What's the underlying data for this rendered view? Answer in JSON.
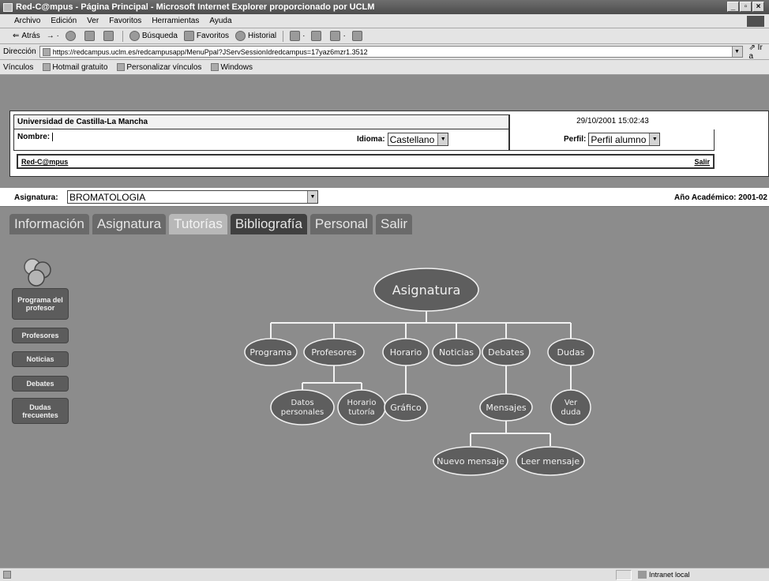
{
  "window": {
    "title": "Red-C@mpus - Página Principal - Microsoft Internet Explorer proporcionado por UCLM"
  },
  "menu": [
    "Archivo",
    "Edición",
    "Ver",
    "Favoritos",
    "Herramientas",
    "Ayuda"
  ],
  "toolbar": {
    "back": "Atrás",
    "search": "Búsqueda",
    "favorites": "Favoritos",
    "history": "Historial"
  },
  "address": {
    "label": "Dirección",
    "url": "https://redcampus.uclm.es/redcampusapp/MenuPpal?JServSessionIdredcampus=17yaz6mzr1.3512",
    "go": "Ir a"
  },
  "links": {
    "label": "Vínculos",
    "items": [
      "Hotmail gratuito",
      "Personalizar vínculos",
      "Windows"
    ]
  },
  "header": {
    "university": "Universidad de Castilla-La Mancha",
    "datetime": "29/10/2001 15:02:43",
    "nombre_label": "Nombre:",
    "idioma_label": "Idioma:",
    "idioma_value": "Castellano",
    "perfil_label": "Perfil:",
    "perfil_value": "Perfil alumno",
    "home_link": "Red-C@mpus",
    "salir_link": "Salir"
  },
  "asignatura": {
    "label": "Asignatura:",
    "value": "BROMATOLOGIA",
    "anio": "Año Académico: 2001-02"
  },
  "tabs": [
    "Información",
    "Asignatura",
    "Tutorías",
    "Bibliografía",
    "Personal",
    "Salir"
  ],
  "sidebar": [
    "Programa del profesor",
    "Profesores",
    "Noticias",
    "Debates",
    "Dudas frecuentes"
  ],
  "diagram": {
    "root": "Asignatura",
    "nodes": {
      "programa": "Programa",
      "profesores": "Profesores",
      "horario": "Horario",
      "noticias": "Noticias",
      "debates": "Debates",
      "dudas": "Dudas",
      "datos_1": "Datos",
      "datos_2": "personales",
      "htutoria_1": "Horario",
      "htutoria_2": "tutoría",
      "grafico": "Gráfico",
      "mensajes": "Mensajes",
      "verduda_1": "Ver",
      "verduda_2": "duda",
      "nuevo": "Nuevo mensaje",
      "leer": "Leer mensaje"
    }
  },
  "status": {
    "zone": "Intranet local"
  }
}
